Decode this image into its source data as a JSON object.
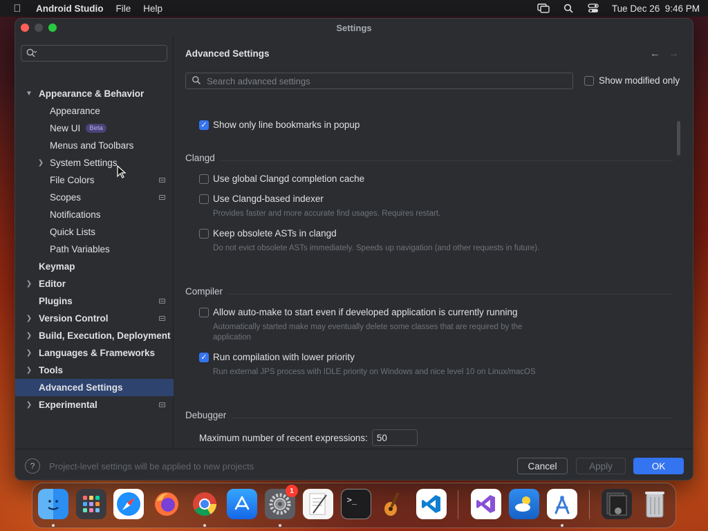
{
  "menubar": {
    "app_name": "Android Studio",
    "menus": [
      "File",
      "Help"
    ],
    "datetime": "Tue Dec 26  9:46 PM"
  },
  "window": {
    "title": "Settings"
  },
  "sidebar": {
    "search_placeholder": "",
    "items": [
      {
        "label": "Appearance & Behavior",
        "level": 0,
        "expanded": true
      },
      {
        "label": "Appearance",
        "level": 1
      },
      {
        "label": "New UI",
        "level": 1,
        "badge": "Beta"
      },
      {
        "label": "Menus and Toolbars",
        "level": 1
      },
      {
        "label": "System Settings",
        "level": 1,
        "collapsed": true
      },
      {
        "label": "File Colors",
        "level": 1,
        "project_tag": true
      },
      {
        "label": "Scopes",
        "level": 1,
        "project_tag": true
      },
      {
        "label": "Notifications",
        "level": 1
      },
      {
        "label": "Quick Lists",
        "level": 1
      },
      {
        "label": "Path Variables",
        "level": 1
      },
      {
        "label": "Keymap",
        "level": 0
      },
      {
        "label": "Editor",
        "level": 0,
        "collapsed": true
      },
      {
        "label": "Plugins",
        "level": 0,
        "project_tag": true
      },
      {
        "label": "Version Control",
        "level": 0,
        "collapsed": true,
        "project_tag": true
      },
      {
        "label": "Build, Execution, Deployment",
        "level": 0,
        "collapsed": true
      },
      {
        "label": "Languages & Frameworks",
        "level": 0,
        "collapsed": true
      },
      {
        "label": "Tools",
        "level": 0,
        "collapsed": true
      },
      {
        "label": "Advanced Settings",
        "level": 0,
        "selected": true
      },
      {
        "label": "Experimental",
        "level": 0,
        "collapsed": true,
        "project_tag": true
      }
    ]
  },
  "main": {
    "title": "Advanced Settings",
    "search_placeholder": "Search advanced settings",
    "modified_only_label": "Show modified only",
    "bookmarks_option": "Show only line bookmarks in popup",
    "sections": {
      "clangd": "Clangd",
      "compiler": "Compiler",
      "debugger": "Debugger"
    },
    "options": {
      "clangd_cache": "Use global Clangd completion cache",
      "clangd_indexer": "Use Clangd-based indexer",
      "clangd_indexer_desc": "Provides faster and more accurate find usages. Requires restart.",
      "clangd_asts": "Keep obsolete ASTs in clangd",
      "clangd_asts_desc": "Do not evict obsolete ASTs immediately. Speeds up navigation (and other requests in future).",
      "auto_make": "Allow auto-make to start even if developed application is currently running",
      "auto_make_desc": "Automatically started make may eventually delete some classes that are required by the application",
      "low_priority": "Run compilation with lower priority",
      "low_priority_desc": "Run external JPS process with IDLE priority on Windows and nice level 10 on Linux/macOS",
      "max_expr_label": "Maximum number of recent expressions:",
      "max_expr_value": "50"
    }
  },
  "footer": {
    "help": "?",
    "note": "Project-level settings will be applied to new projects",
    "cancel": "Cancel",
    "apply": "Apply",
    "ok": "OK"
  },
  "dock": {
    "settings_badge": "1"
  },
  "colors": {
    "accent": "#3574f0",
    "selection": "#2e436e",
    "background": "#2b2d30"
  }
}
